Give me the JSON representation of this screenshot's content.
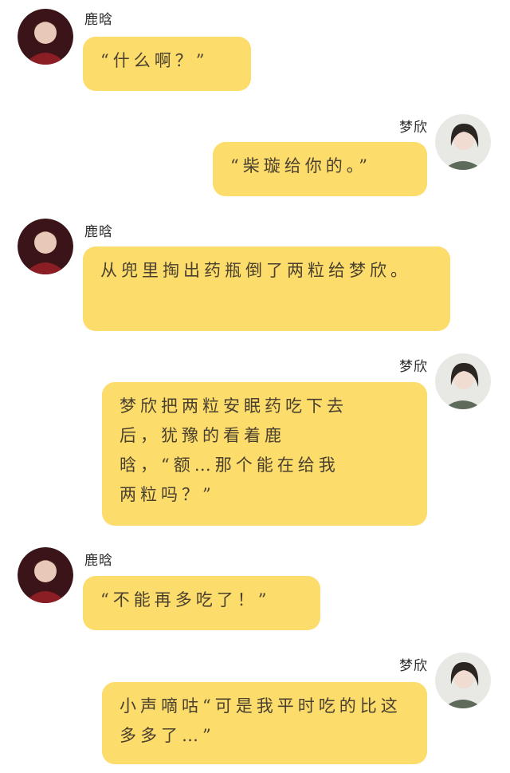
{
  "chat": {
    "names": {
      "male": "鹿晗",
      "female": "梦欣"
    },
    "messages": [
      {
        "sender": "鹿晗",
        "text": "“什么啊？”"
      },
      {
        "sender": "梦欣",
        "text": "“柴璇给你的。”"
      },
      {
        "sender": "鹿晗",
        "text": "从兜里掏出药瓶倒了两粒给梦欣。"
      },
      {
        "sender": "梦欣",
        "text": "梦欣把两粒安眠药吃下去后，犹豫的看着鹿晗，“额…那个能在给我两粒吗？”"
      },
      {
        "sender": "鹿晗",
        "text": "“不能再多吃了！”"
      },
      {
        "sender": "梦欣",
        "text": "小声嘀咕“可是我平时吃的比这多多了…”"
      }
    ]
  },
  "colors": {
    "bubble": "#fcdc6b",
    "text": "#4a4030",
    "background": "#ffffff"
  }
}
